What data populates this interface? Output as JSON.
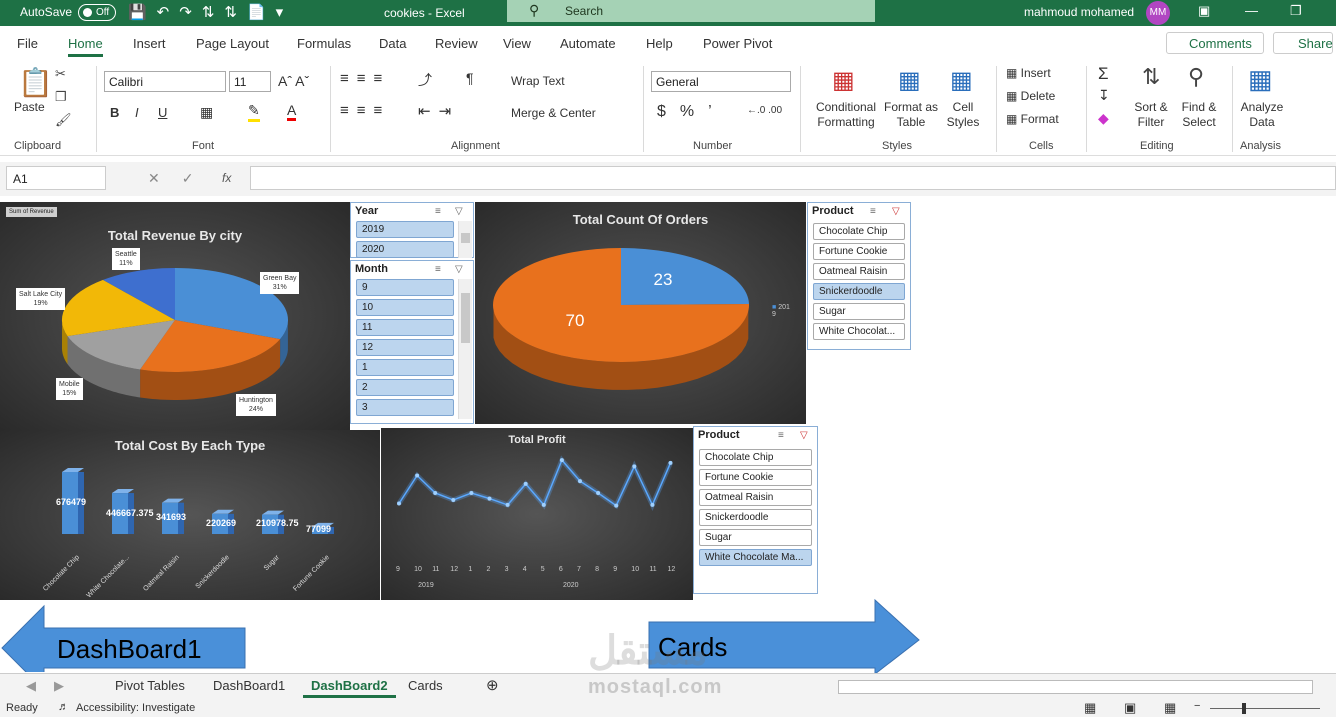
{
  "titlebar": {
    "autosave": "AutoSave",
    "toggle": "Off",
    "title": "cookies  -  Excel",
    "search": "Search",
    "user": "mahmoud mohamed",
    "initials": "MM"
  },
  "menu": {
    "items": [
      "File",
      "Home",
      "Insert",
      "Page Layout",
      "Formulas",
      "Data",
      "Review",
      "View",
      "Automate",
      "Help",
      "Power Pivot"
    ],
    "comments": "Comments",
    "share": "Share"
  },
  "ribbon": {
    "clipboard": {
      "label": "Clipboard",
      "paste": "Paste"
    },
    "font": {
      "label": "Font",
      "name": "Calibri",
      "size": "11",
      "bold": "B",
      "italic": "I",
      "underline": "U"
    },
    "alignment": {
      "label": "Alignment",
      "wrap": "Wrap Text",
      "merge": "Merge & Center"
    },
    "number": {
      "label": "Number",
      "format": "General"
    },
    "styles": {
      "label": "Styles",
      "conditional": [
        "Conditional",
        "Formatting"
      ],
      "format_table": [
        "Format as",
        "Table"
      ],
      "cell_styles": [
        "Cell",
        "Styles"
      ]
    },
    "cells": {
      "label": "Cells",
      "insert": "Insert",
      "delete": "Delete",
      "format": "Format"
    },
    "editing": {
      "label": "Editing",
      "sort": [
        "Sort &",
        "Filter"
      ],
      "find": [
        "Find &",
        "Select"
      ]
    },
    "analysis": {
      "label": "Analysis",
      "analyze": [
        "Analyze",
        "Data"
      ]
    }
  },
  "formula": {
    "cell": "A1",
    "fx": "fx"
  },
  "revenue_chart": {
    "title": "Total Revenue By city",
    "field_button": "Sum of Revenue",
    "chart_data": {
      "type": "pie",
      "categories": [
        "Green Bay",
        "Huntington",
        "Mobile",
        "Salt Lake City",
        "Seattle"
      ],
      "values": [
        31,
        24,
        15,
        19,
        11
      ],
      "labels": {
        "Green Bay": "31%",
        "Huntington": "24%",
        "Mobile": "15%",
        "Salt Lake City": "19%",
        "Seattle": "11%"
      },
      "colors": [
        "#4a8fd6",
        "#e8711d",
        "#a0a0a0",
        "#f2b807",
        "#3e6fcf"
      ]
    }
  },
  "year_slicer": {
    "header": "Year",
    "items": [
      "2019",
      "2020"
    ]
  },
  "month_slicer": {
    "header": "Month",
    "items": [
      "9",
      "10",
      "11",
      "12",
      "1",
      "2",
      "3"
    ]
  },
  "orders_chart": {
    "title": "Total Count Of Orders",
    "legend": "2019",
    "chart_data": {
      "type": "pie",
      "values": [
        23,
        70
      ],
      "labels": [
        "23",
        "70"
      ],
      "colors": [
        "#4a8fd6",
        "#e8711d"
      ]
    }
  },
  "product_slicer_1": {
    "header": "Product",
    "items": [
      "Chocolate Chip",
      "Fortune Cookie",
      "Oatmeal Raisin",
      "Snickerdoodle",
      "Sugar",
      "White Chocolat..."
    ],
    "selected": 3
  },
  "cost_chart": {
    "title": "Total Cost By Each Type",
    "chart_data": {
      "type": "bar",
      "categories": [
        "Chocolate Chip",
        "White Chocolate...",
        "Oatmeal Raisin",
        "Snickerdoodle",
        "Sugar",
        "Fortune Cookie"
      ],
      "values": [
        676479,
        446667.375,
        341693,
        220269,
        210978.75,
        77099
      ],
      "value_labels": [
        "676479",
        "446667.375",
        "341693",
        "220269",
        "210978.75",
        "77099"
      ]
    }
  },
  "profit_chart": {
    "title": "Total Profit",
    "chart_data": {
      "type": "line",
      "x": [
        "9",
        "10",
        "11",
        "12",
        "1",
        "2",
        "3",
        "4",
        "5",
        "6",
        "7",
        "8",
        "9",
        "10",
        "11",
        "12"
      ],
      "groups": [
        {
          "label": "2019",
          "start": 0,
          "end": 3
        },
        {
          "label": "2020",
          "start": 4,
          "end": 15
        }
      ],
      "values": [
        0.35,
        0.75,
        0.5,
        0.4,
        0.5,
        0.42,
        0.33,
        0.63,
        0.33,
        0.97,
        0.67,
        0.5,
        0.32,
        0.88,
        0.33,
        0.93
      ],
      "color": "#5aa8ff"
    }
  },
  "product_slicer_2": {
    "header": "Product",
    "items": [
      "Chocolate Chip",
      "Fortune Cookie",
      "Oatmeal Raisin",
      "Snickerdoodle",
      "Sugar",
      "White Chocolate Ma..."
    ],
    "selected": 5
  },
  "nav": {
    "left": "DashBoard1",
    "right": "Cards"
  },
  "tabs": {
    "items": [
      "Pivot Tables",
      "DashBoard1",
      "DashBoard2",
      "Cards"
    ],
    "active": 2
  },
  "status": {
    "ready": "Ready",
    "accessibility": "Accessibility: Investigate"
  },
  "watermark": {
    "arabic": "مستقل",
    "latin": "mostaql.com"
  }
}
